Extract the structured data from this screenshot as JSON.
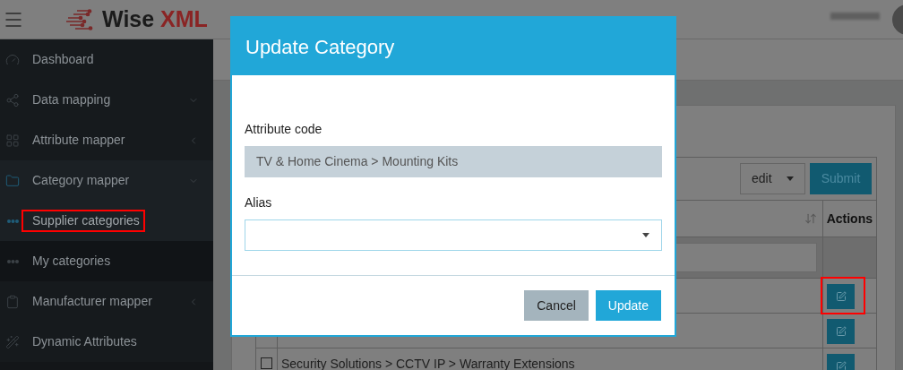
{
  "header": {
    "logo": "Wise",
    "logo_accent": "XML"
  },
  "sidebar": {
    "items": [
      {
        "label": "Dashboard",
        "highlighted": false,
        "selected": false
      },
      {
        "label": "Data mapping",
        "highlighted": false,
        "selected": false
      },
      {
        "label": "Attribute mapper",
        "highlighted": false,
        "selected": false
      },
      {
        "label": "Category mapper",
        "highlighted": false,
        "selected": true,
        "children": [
          {
            "label": "Supplier categories",
            "highlighted": true,
            "selected": true
          },
          {
            "label": "My categories",
            "highlighted": false,
            "selected": false
          }
        ]
      },
      {
        "label": "Manufacturer mapper",
        "highlighted": false,
        "selected": false
      },
      {
        "label": "Dynamic Attributes",
        "highlighted": false,
        "selected": false
      }
    ]
  },
  "table": {
    "action_select": "edit",
    "submit": "Submit",
    "columns": [
      {
        "label": "Actions"
      }
    ],
    "rows": [
      {
        "highlighted": true
      },
      {
        "highlighted": false
      },
      {
        "checked": false,
        "name": "Security Solutions > CCTV IP > Warranty Extensions",
        "highlighted": false
      }
    ]
  },
  "dialog": {
    "title": "Update Category",
    "fields": [
      {
        "label": "Attribute code",
        "kind": "readonly",
        "value": "TV & Home Cinema > Mounting Kits"
      },
      {
        "label": "Alias",
        "kind": "select"
      }
    ],
    "buttons": [
      {
        "label": "Cancel",
        "kind": "secondary"
      },
      {
        "label": "Update",
        "kind": "primary"
      }
    ]
  }
}
